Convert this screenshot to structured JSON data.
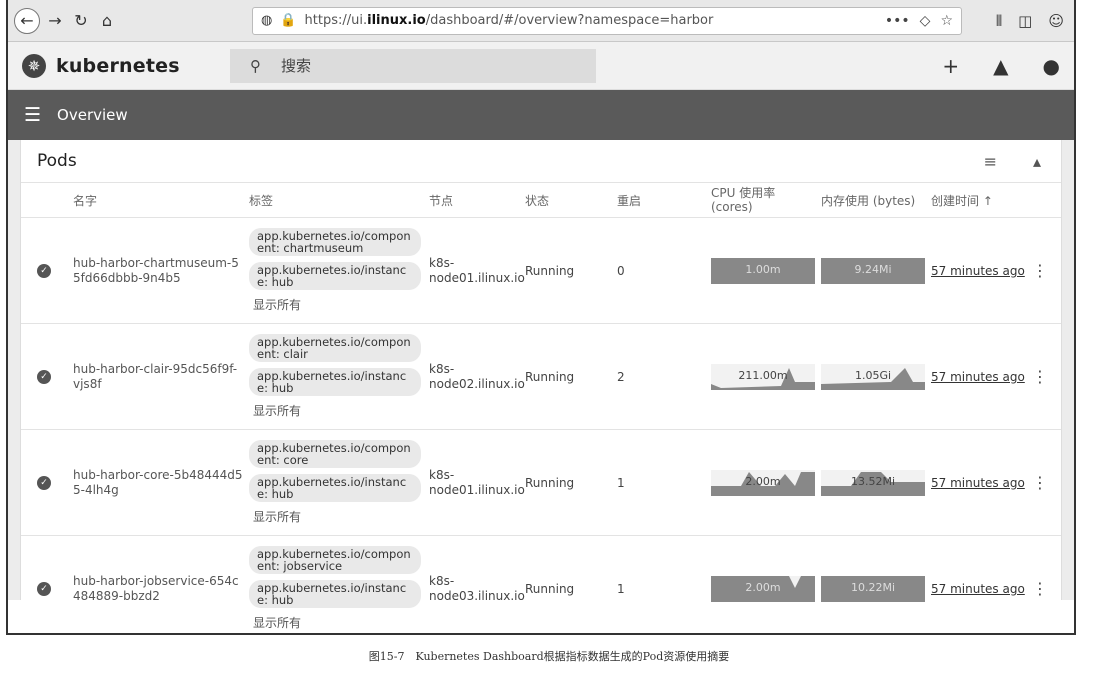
{
  "browser": {
    "url_prefix": "https://ui.",
    "url_domain": "ilinux.io",
    "url_path": "/dashboard/#/overview?namespace=harbor",
    "more_icon": "more-icon"
  },
  "header": {
    "brand": "kubernetes",
    "search_placeholder": "搜索"
  },
  "overview": {
    "title": "Overview"
  },
  "pods": {
    "title": "Pods",
    "columns": {
      "name": "名字",
      "labels": "标签",
      "node": "节点",
      "status": "状态",
      "restarts": "重启",
      "cpu": "CPU 使用率\n(cores)",
      "memory": "内存使用 (bytes)",
      "created": "创建时间"
    },
    "rows": [
      {
        "name": "hub-harbor-chartmuseum-55fd66dbbb-9n4b5",
        "label1": "app.kubernetes.io/component: chartmuseum",
        "label2": "app.kubernetes.io/instance: hub",
        "show_all": "显示所有",
        "node": "k8s-node01.ilinux.io",
        "status": "Running",
        "restarts": "0",
        "cpu": "1.00m",
        "memory": "9.24Mi",
        "age": "57 minutes ago"
      },
      {
        "name": "hub-harbor-clair-95dc56f9f-vjs8f",
        "label1": "app.kubernetes.io/component: clair",
        "label2": "app.kubernetes.io/instance: hub",
        "show_all": "显示所有",
        "node": "k8s-node02.ilinux.io",
        "status": "Running",
        "restarts": "2",
        "cpu": "211.00m",
        "memory": "1.05Gi",
        "age": "57 minutes ago"
      },
      {
        "name": "hub-harbor-core-5b48444d55-4lh4g",
        "label1": "app.kubernetes.io/component: core",
        "label2": "app.kubernetes.io/instance: hub",
        "show_all": "显示所有",
        "node": "k8s-node01.ilinux.io",
        "status": "Running",
        "restarts": "1",
        "cpu": "2.00m",
        "memory": "13.52Mi",
        "age": "57 minutes ago"
      },
      {
        "name": "hub-harbor-jobservice-654c484889-bbzd2",
        "label1": "app.kubernetes.io/component: jobservice",
        "label2": "app.kubernetes.io/instance: hub",
        "show_all": "显示所有",
        "node": "k8s-node03.ilinux.io",
        "status": "Running",
        "restarts": "1",
        "cpu": "2.00m",
        "memory": "10.22Mi",
        "age": "57 minutes ago"
      }
    ]
  },
  "caption": "图15-7　Kubernetes Dashboard根据指标数据生成的Pod资源使用摘要"
}
